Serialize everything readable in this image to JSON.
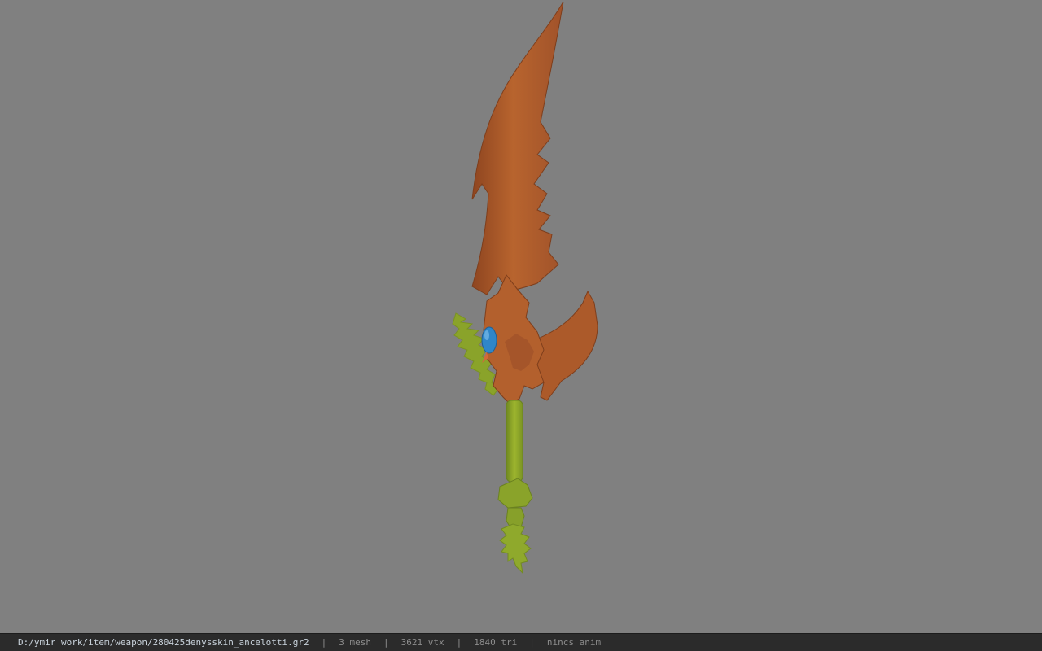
{
  "viewer": {
    "background_color": "#808080",
    "model": {
      "name": "sword-model",
      "blade_color": "#b4602c",
      "hilt_color": "#8fa62a",
      "gem_color": "#2f86c8"
    }
  },
  "statusbar": {
    "file_path": "D:/ymir work/item/weapon/280425denysskin_ancelotti.gr2",
    "separator": "|",
    "mesh_count": "3 mesh",
    "vertex_count": "3621 vtx",
    "triangle_count": "1840 tri",
    "anim_status": "nincs anim"
  }
}
